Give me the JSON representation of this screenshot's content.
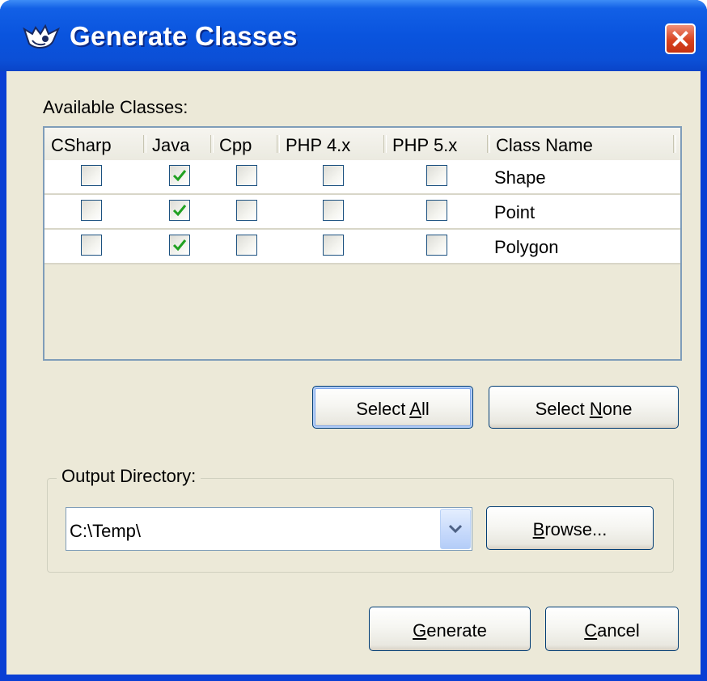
{
  "window": {
    "title": "Generate Classes",
    "icon": "app-logo-icon",
    "close_icon": "close-icon"
  },
  "available_classes": {
    "label": "Available Classes:",
    "columns": [
      "CSharp",
      "Java",
      "Cpp",
      "PHP 4.x",
      "PHP 5.x",
      "Class Name"
    ],
    "rows": [
      {
        "name": "Shape",
        "csharp": false,
        "java": true,
        "cpp": false,
        "php4": false,
        "php5": false
      },
      {
        "name": "Point",
        "csharp": false,
        "java": true,
        "cpp": false,
        "php4": false,
        "php5": false
      },
      {
        "name": "Polygon",
        "csharp": false,
        "java": true,
        "cpp": false,
        "php4": false,
        "php5": false
      }
    ]
  },
  "buttons": {
    "select_all": {
      "pre": "Select ",
      "key": "A",
      "post": "ll"
    },
    "select_none": {
      "pre": "Select ",
      "key": "N",
      "post": "one"
    },
    "browse": {
      "pre": "",
      "key": "B",
      "post": "rowse..."
    },
    "generate": {
      "pre": "",
      "key": "G",
      "post": "enerate"
    },
    "cancel": {
      "pre": "",
      "key": "C",
      "post": "ancel"
    }
  },
  "output_directory": {
    "label": "Output Directory:",
    "value": "C:\\Temp\\",
    "dropdown_icon": "chevron-down-icon"
  },
  "colors": {
    "titlebar": "#0a54de",
    "face": "#ece9d8",
    "check": "#21a121"
  }
}
